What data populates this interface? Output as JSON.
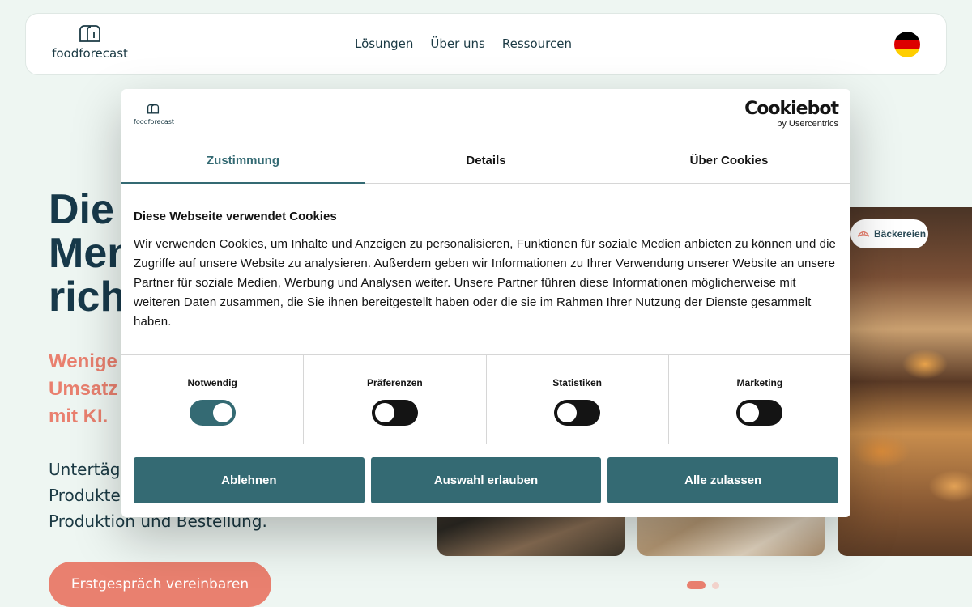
{
  "header": {
    "logo_text": "foodforecast",
    "nav": [
      "Lösungen",
      "Über uns",
      "Ressourcen"
    ],
    "language_icon": "german-flag-icon",
    "flag_colors": [
      "#000000",
      "#dd0000",
      "#ffce00"
    ]
  },
  "hero": {
    "title_lines": [
      "Die",
      "Men",
      "rich"
    ],
    "subtitle_lines": [
      "Wenige",
      "Umsatz",
      "mit KI."
    ],
    "body_lines": [
      "Untertäg",
      "Produkte",
      "Produktion und Bestellung."
    ],
    "cta_label": "Erstgespräch vereinbaren",
    "image_tag": "Bäckereien"
  },
  "cookie_dialog": {
    "logo_text": "foodforecast",
    "provider_name": "Cookiebot",
    "provider_sub": "by Usercentrics",
    "tabs": [
      "Zustimmung",
      "Details",
      "Über Cookies"
    ],
    "active_tab": "Zustimmung",
    "heading": "Diese Webseite verwendet Cookies",
    "text": "Wir verwenden Cookies, um Inhalte und Anzeigen zu personalisieren, Funktionen für soziale Medien anbieten zu können und die Zugriffe auf unsere Website zu analysieren. Außerdem geben wir Informationen zu Ihrer Verwendung unserer Website an unsere Partner für soziale Medien, Werbung und Analysen weiter. Unsere Partner führen diese Informationen möglicherweise mit weiteren Daten zusammen, die Sie ihnen bereitgestellt haben oder die sie im Rahmen Ihrer Nutzung der Dienste gesammelt haben.",
    "toggles": [
      {
        "label": "Notwendig",
        "on": true
      },
      {
        "label": "Präferenzen",
        "on": false
      },
      {
        "label": "Statistiken",
        "on": false
      },
      {
        "label": "Marketing",
        "on": false
      }
    ],
    "buttons": {
      "decline": "Ablehnen",
      "allow_selection": "Auswahl erlauben",
      "allow_all": "Alle zulassen"
    }
  },
  "colors": {
    "accent": "#346a73",
    "brand_coral": "#e9806f",
    "text_dark": "#17394a",
    "background": "#eef6f2"
  }
}
